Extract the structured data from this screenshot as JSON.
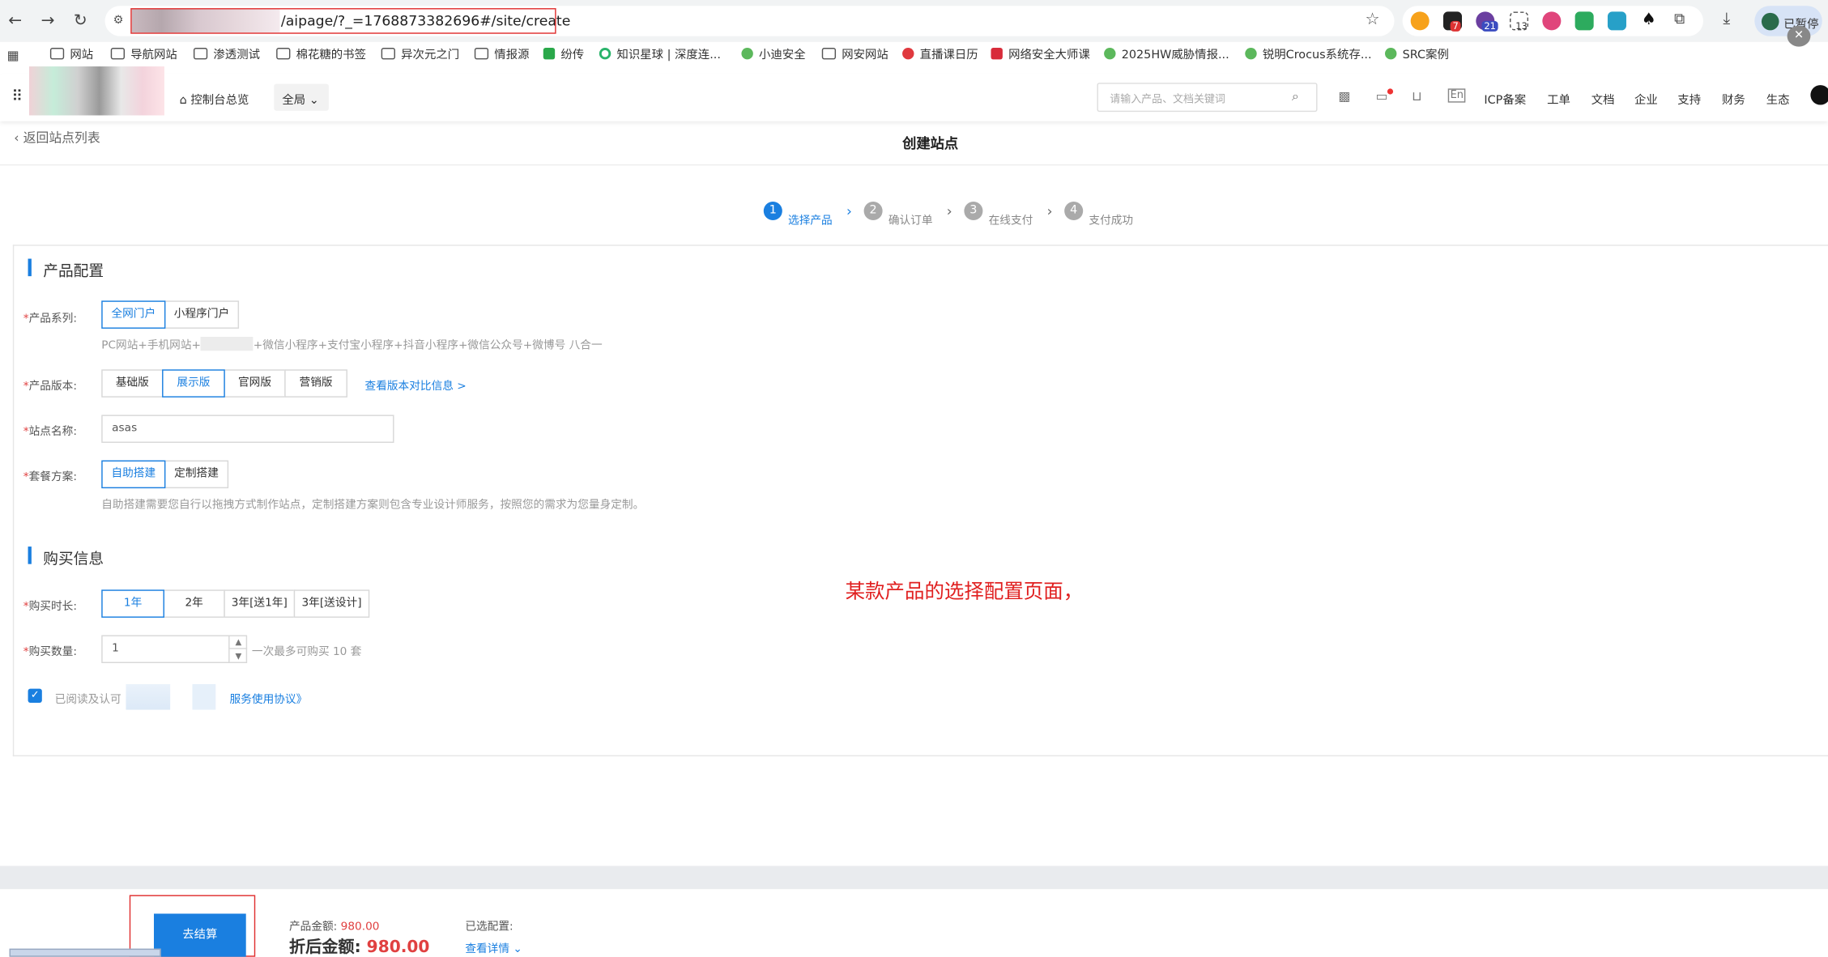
{
  "browser": {
    "url_suffix": "/aipage/?_=1768873382696#/site/create",
    "ext_badges": [
      "7",
      "21",
      "13"
    ],
    "profile_label": "已暂停",
    "bookmarks": [
      "网站",
      "导航网站",
      "渗透测试",
      "棉花糖的书签",
      "异次元之门",
      "情报源",
      "纷传",
      "知识星球 | 深度连...",
      "小迪安全",
      "网安网站",
      "直播课日历",
      "网络安全大师课",
      "2025HW威胁情报...",
      "锐明Crocus系统存...",
      "SRC案例"
    ]
  },
  "header": {
    "overview": "控制台总览",
    "region": "全局",
    "search_placeholder": "请输入产品、文档关键词",
    "nav": [
      "ICP备案",
      "工单",
      "文档",
      "企业",
      "支持",
      "财务",
      "生态"
    ]
  },
  "page": {
    "back": "返回站点列表",
    "title": "创建站点",
    "steps": [
      {
        "num": "1",
        "label": "选择产品"
      },
      {
        "num": "2",
        "label": "确认订单"
      },
      {
        "num": "3",
        "label": "在线支付"
      },
      {
        "num": "4",
        "label": "支付成功"
      }
    ]
  },
  "product_config": {
    "section_title": "产品配置",
    "series_label": "产品系列:",
    "series_options": [
      "全网门户",
      "小程序门户"
    ],
    "series_hint_a": "PC网站+手机网站+",
    "series_hint_b": "+微信小程序+支付宝小程序+抖音小程序+微信公众号+微博号 八合一",
    "version_label": "产品版本:",
    "version_options": [
      "基础版",
      "展示版",
      "官网版",
      "营销版"
    ],
    "version_compare": "查看版本对比信息 >",
    "site_name_label": "站点名称:",
    "site_name_value": "asas",
    "plan_label": "套餐方案:",
    "plan_options": [
      "自助搭建",
      "定制搭建"
    ],
    "plan_hint": "自助搭建需要您自行以拖拽方式制作站点，定制搭建方案则包含专业设计师服务，按照您的需求为您量身定制。"
  },
  "purchase": {
    "section_title": "购买信息",
    "duration_label": "购买时长:",
    "duration_options": [
      "1年",
      "2年",
      "3年[送1年]",
      "3年[送设计]"
    ],
    "quantity_label": "购买数量:",
    "quantity_value": "1",
    "quantity_hint": "一次最多可购买 10 套",
    "agree_text": "已阅读及认可《",
    "agree_link": "服务使用协议》"
  },
  "annotation": "某款产品的选择配置页面，",
  "footer": {
    "checkout": "去结算",
    "amount_label": "产品金额:",
    "amount_value": "980.00",
    "discount_label": "折后金额:",
    "discount_value": "980.00",
    "selected_label": "已选配置:",
    "details_link": "查看详情"
  },
  "colors": {
    "accent": "#1a7fe0",
    "price": "#e04040",
    "annotation": "#e02020"
  }
}
